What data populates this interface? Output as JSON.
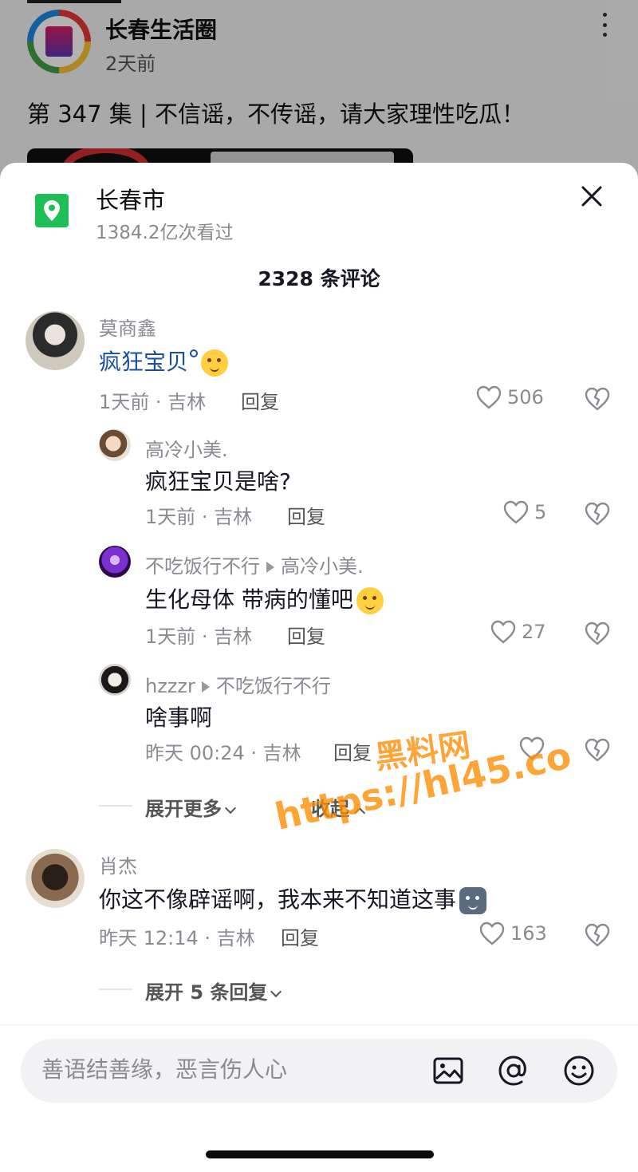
{
  "post": {
    "account_name": "长春生活圈",
    "time": "2天前",
    "title": "第 347 集 | 不信谣，不传谣，请大家理性吃瓜！"
  },
  "sheet": {
    "location_name": "长春市",
    "views": "1384.2亿次看过",
    "comment_count": "2328 条评论",
    "accent_color": "#1fbf58"
  },
  "comments": [
    {
      "user": "莫商鑫",
      "text": "疯狂宝贝",
      "meta": "1天前 · 吉林",
      "reply_label": "回复",
      "likes": "506",
      "replies": [
        {
          "user": "高冷小美.",
          "reply_to": "",
          "text": "疯狂宝贝是啥?",
          "meta": "1天前 · 吉林",
          "reply_label": "回复",
          "likes": "5"
        },
        {
          "user": "不吃饭行不行",
          "reply_to": "高冷小美.",
          "text": "生化母体 带病的懂吧",
          "meta": "1天前 · 吉林",
          "reply_label": "回复",
          "likes": "27"
        },
        {
          "user": "hzzzr",
          "reply_to": "不吃饭行不行",
          "text": "啥事啊",
          "meta": "昨天 00:24 · 吉林",
          "reply_label": "回复",
          "likes": ""
        }
      ],
      "expand_more": "展开更多",
      "collapse": "收起"
    },
    {
      "user": "肖杰",
      "text": "你这不像辟谣啊，我本来不知道这事",
      "meta": "昨天 12:14 · 吉林",
      "reply_label": "回复",
      "likes": "163",
      "expand_more": "展开 5 条回复"
    }
  ],
  "input": {
    "placeholder": "善语结善缘，恶言伤人心"
  },
  "watermark": {
    "line1": "黑料网",
    "line2": "https://hl45.co"
  }
}
